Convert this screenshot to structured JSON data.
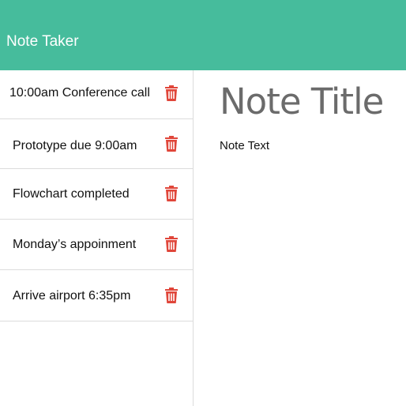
{
  "app": {
    "brand": "Note Taker",
    "accent_color": "#46bc9c",
    "delete_color": "#e0463a"
  },
  "sidebar": {
    "notes": [
      {
        "label": "10:00am Conference call",
        "icon": "trash-icon"
      },
      {
        "label": "Prototype due 9:00am",
        "icon": "trash-icon"
      },
      {
        "label": "Flowchart completed",
        "icon": "trash-icon"
      },
      {
        "label": "Monday’s appoinment",
        "icon": "trash-icon"
      },
      {
        "label": "Arrive airport 6:35pm",
        "icon": "trash-icon"
      }
    ]
  },
  "editor": {
    "title_placeholder": "Note Title",
    "title_value": "",
    "text_placeholder": "Note Text",
    "text_value": ""
  }
}
